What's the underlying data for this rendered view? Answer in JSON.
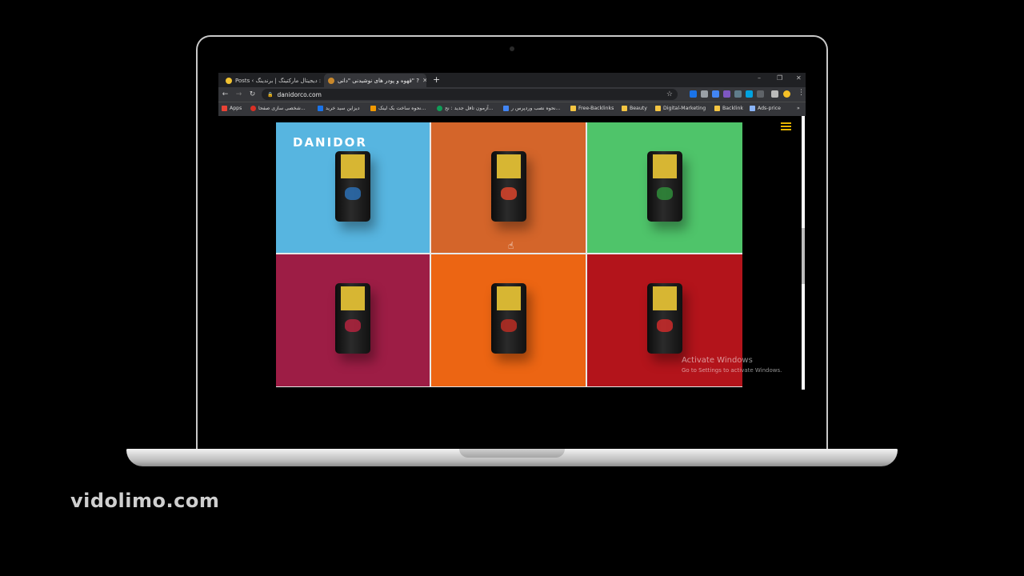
{
  "browser": {
    "tabs": [
      {
        "title": "Posts ‹ دیجیتال مارکتینگ | برندینگ :",
        "active": false
      },
      {
        "title": "قهوه و پودر های نوشیدنی \"دانی\" ?",
        "active": true
      }
    ],
    "new_tab": "+",
    "window_buttons": {
      "minimize": "–",
      "restore": "❐",
      "close": "✕"
    },
    "url": "danidorco.com",
    "bookmarks": [
      "Apps",
      "شخصی سازی صفحا...",
      "دیزاین سید خرید",
      "نحوه ساخت بک لینک...",
      "آزمون تافل جدید : نح...",
      "نحوه نصب وردپرس ر...",
      "Free-Backlinks",
      "Beauty",
      "Digital-Marketing",
      "Backlink",
      "Ads-price"
    ],
    "overflow": "»"
  },
  "site": {
    "logo": "DANIDOR",
    "tiles": [
      {
        "bg": "#57b5e0",
        "art": "#2b6fb3"
      },
      {
        "bg": "#d4652a",
        "art": "#d9442b"
      },
      {
        "bg": "#4fc46a",
        "art": "#2f8c3a"
      },
      {
        "bg": "#9d1d45",
        "art": "#b3233e"
      },
      {
        "bg": "#ec6513",
        "art": "#b82d23"
      },
      {
        "bg": "#b3141b",
        "art": "#cc2a2a"
      }
    ]
  },
  "os_watermark": {
    "line1": "Activate Windows",
    "line2": "Go to Settings to activate Windows."
  },
  "video_watermark": "vidolimo.com"
}
